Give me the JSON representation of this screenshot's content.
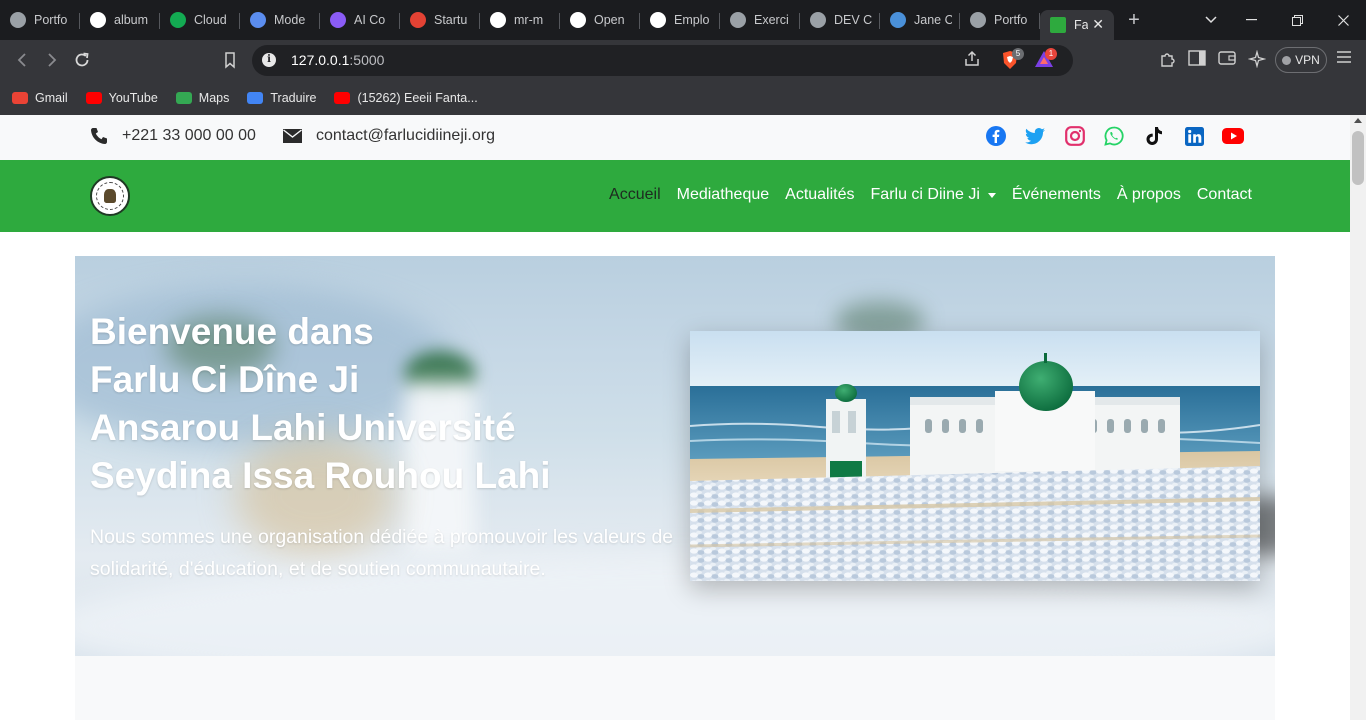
{
  "browser": {
    "tabs": [
      {
        "label": "Portfo",
        "favicon_color": "#9aa0a6"
      },
      {
        "label": "album",
        "favicon_color": "#ffffff"
      },
      {
        "label": "Cloud",
        "favicon_color": "#13aa52"
      },
      {
        "label": "Mode",
        "favicon_color": "#5b8def"
      },
      {
        "label": "AI Co",
        "favicon_color": "#8b5cf6"
      },
      {
        "label": "Startu",
        "favicon_color": "#e34234"
      },
      {
        "label": "mr-m",
        "favicon_color": "#ffffff"
      },
      {
        "label": "Open",
        "favicon_color": "#ffffff"
      },
      {
        "label": "Emplo",
        "favicon_color": "#ffffff"
      },
      {
        "label": "Exerci",
        "favicon_color": "#9aa0a6"
      },
      {
        "label": "DEV C",
        "favicon_color": "#9aa0a6"
      },
      {
        "label": "Jane C",
        "favicon_color": "#4a90d9"
      },
      {
        "label": "Portfo",
        "favicon_color": "#9aa0a6"
      }
    ],
    "active_tab": {
      "label": "Fa",
      "favicon_color": "#2eaa3e"
    },
    "url": {
      "host": "127.0.0.1",
      "port": ":5000"
    },
    "brave_badge": "5",
    "alert_badge": "1",
    "vpn_label": "VPN",
    "bookmarks": [
      {
        "label": "Gmail",
        "color": "#ea4335"
      },
      {
        "label": "YouTube",
        "color": "#ff0000"
      },
      {
        "label": "Maps",
        "color": "#34a853"
      },
      {
        "label": "Traduire",
        "color": "#4285f4"
      },
      {
        "label": "(15262) Eeeii Fanta...",
        "color": "#ff0000"
      }
    ]
  },
  "topbar": {
    "phone": "+221 33 000 00 00",
    "email": "contact@farlucidiineji.org",
    "social": [
      {
        "name": "facebook",
        "color": "#1877f2"
      },
      {
        "name": "twitter",
        "color": "#1da1f2"
      },
      {
        "name": "instagram",
        "color": "#e1306c"
      },
      {
        "name": "whatsapp",
        "color": "#25d366"
      },
      {
        "name": "tiktok",
        "color": "#000000"
      },
      {
        "name": "linkedin",
        "color": "#0a66c2"
      },
      {
        "name": "youtube",
        "color": "#ff0000"
      }
    ]
  },
  "nav": {
    "brand_color": "#2eaa3e",
    "links": [
      "Accueil",
      "Mediatheque",
      "Actualités",
      "Farlu ci Diine Ji",
      "Événements",
      "À propos",
      "Contact"
    ],
    "active_index": 0
  },
  "hero": {
    "title_lines": [
      "Bienvenue dans",
      "Farlu Ci Dîne Ji",
      "Ansarou Lahi Université",
      "Seydina Issa Rouhou Lahi"
    ],
    "subtitle": "Nous sommes une organisation dédiée à promouvoir les valeurs de solidarité, d'éducation, et de soutien communautaire."
  }
}
